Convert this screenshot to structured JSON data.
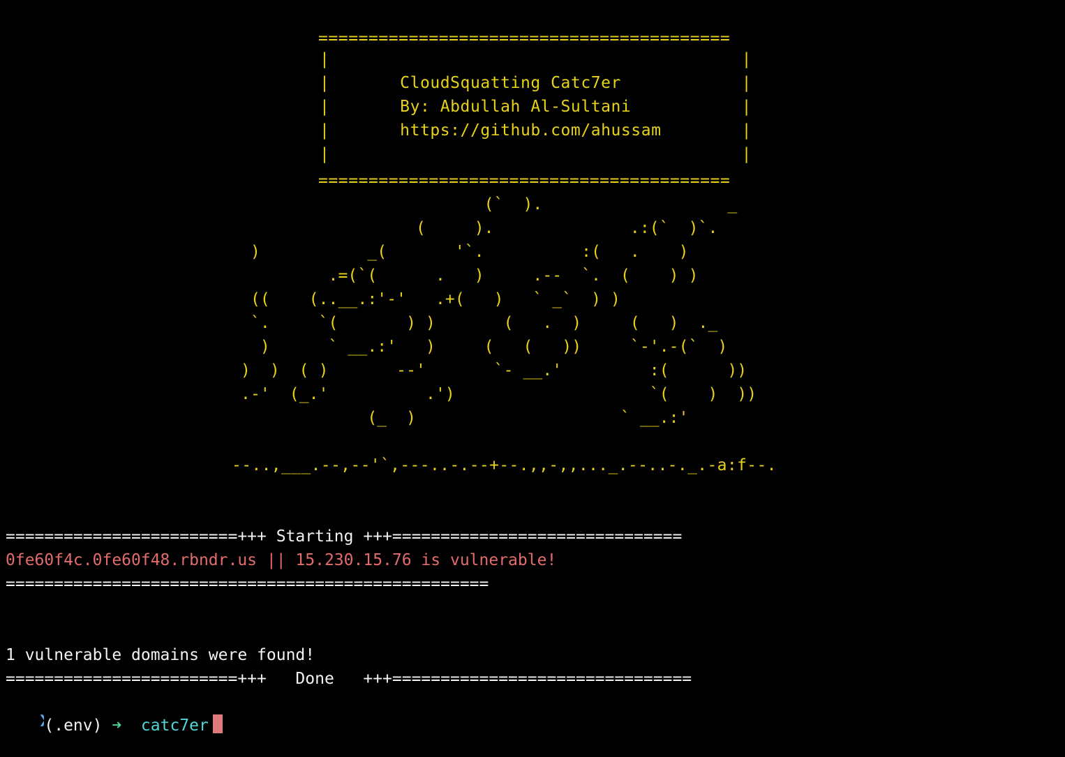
{
  "terminal": {
    "banner": {
      "border_top": "=========================================",
      "box_lines": [
        "|                                         |",
        "|       CloudSquatting Catc7er            |",
        "|       By: Abdullah Al-Sultani           |",
        "|       https://github.com/ahussam        |",
        "|                                         |"
      ],
      "border_bottom": "========================================="
    },
    "ascii_art": [
      "                         (`  ).                   _",
      "                  (     ).              .:(`  )`.",
      " )           _(       '`.          :(   .    )",
      "         .=(`(      .   )     .--  `.  (    ) )",
      " ((    (..__.:'-'   .+(   )   ` _`  ) )",
      " `.     `(       ) )       (   .  )     (   )  ._",
      "  )      ` __.:'   )     (   (   ))     `-'.-(`  )",
      ")  )  ( )       --'       `- __.'         :(      ))",
      ".-'  (_.'          .')                    `(    )  ))",
      "             (_  )                     ` __.:'",
      "--..,___.--,--'`,---..-.--+--.,,-,,..._.--..-._.-a:f--."
    ],
    "run": {
      "starting_line": "========================+++ Starting +++==============================",
      "result_line": "0fe60f4c.0fe60f48.rbndr.us || 15.230.15.76 is vulnerable!",
      "separator_line": "==================================================",
      "summary_line": "1 vulnerable domains were found!",
      "done_line": "========================+++   Done   +++==============================="
    },
    "prompt": {
      "marker": "❯",
      "env": "(.env)",
      "arrow": "➜",
      "directory": "catc7er"
    }
  },
  "colors": {
    "background": "#000000",
    "banner": "#e6d21a",
    "vulnerable": "#e26c6c",
    "text": "#f2f2f2",
    "directory": "#4fd6d6",
    "arrow": "#4ecf8e",
    "cursor": "#e07a7a"
  }
}
